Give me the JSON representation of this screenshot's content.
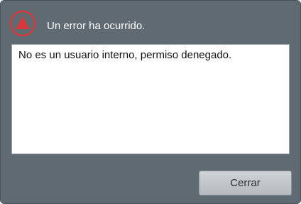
{
  "dialog": {
    "title": "Un error ha ocurrido.",
    "icon": "warning-triangle-icon",
    "message": "No es un usuario interno, permiso denegado.",
    "close_label": "Cerrar"
  },
  "colors": {
    "dialog_background": "#5f6a72",
    "icon_red": "#d43a3a",
    "message_background": "#ffffff",
    "button_background": "#c2c7cb"
  }
}
